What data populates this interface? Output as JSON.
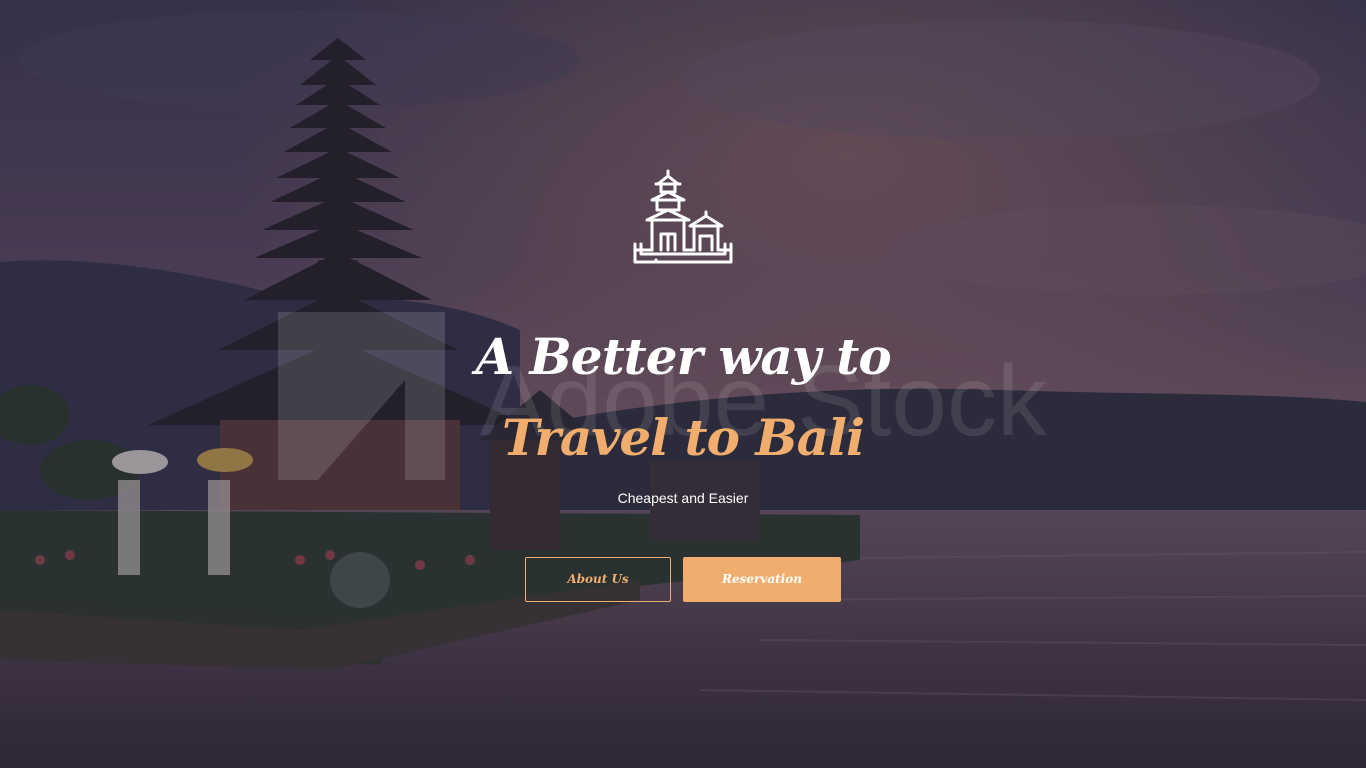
{
  "colors": {
    "accent": "#f0ad6e",
    "text": "#ffffff",
    "overlay": "#2d2838"
  },
  "hero": {
    "logo_icon": "bali-temple-icon",
    "headline_line1": "A Better way to",
    "headline_line2": "Travel to Bali",
    "tagline": "Cheapest and Easier",
    "watermark": "Adobe Stock"
  },
  "buttons": {
    "about_label": "About Us",
    "reservation_label": "Reservation"
  }
}
